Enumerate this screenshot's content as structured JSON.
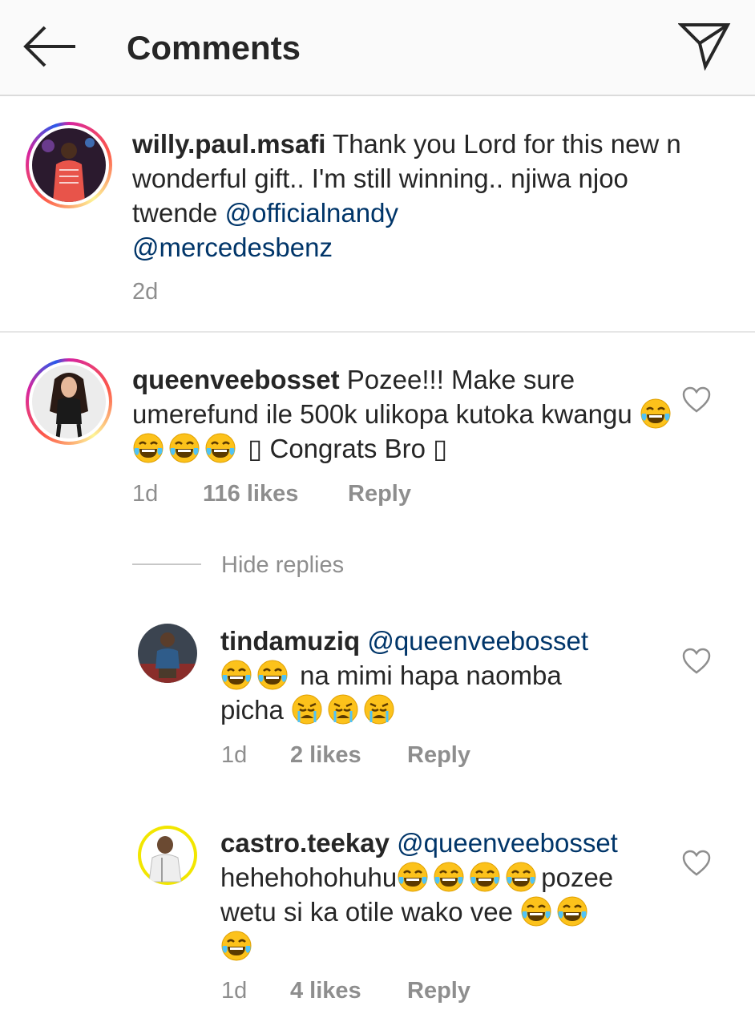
{
  "header": {
    "title": "Comments"
  },
  "caption": {
    "username": "willy.paul.msafi",
    "text": "Thank you Lord for this new n wonderful gift.. I'm still winning.. njiwa njoo twende",
    "mention1": "@officialnandy",
    "mention2": "@mercedesbenz",
    "time": "2d"
  },
  "comment1": {
    "username": "queenveebosset",
    "text_a": "Pozee!!! Make sure umerefund ile 500k ulikopa kutoka kwangu",
    "text_b": "▯ Congrats Bro ▯",
    "time": "1d",
    "likes": "116 likes",
    "reply": "Reply"
  },
  "hide_replies": "Hide replies",
  "reply1": {
    "username": "tindamuziq",
    "mention": "@queenveebosset",
    "text_a": "na mimi hapa naomba",
    "text_b": "picha",
    "time": "1d",
    "likes": "2 likes",
    "reply": "Reply"
  },
  "reply2": {
    "username": "castro.teekay",
    "mention": "@queenveebosset",
    "text_a": "hehehohohuhu",
    "text_b": "pozee",
    "text_c": "wetu si ka otile wako vee",
    "time": "1d",
    "likes": "4 likes",
    "reply": "Reply"
  },
  "colors": {
    "mention": "#003569",
    "meta": "#8e8e8e",
    "header_bg": "#fafafa"
  },
  "icons": [
    "back-arrow-icon",
    "send-icon",
    "heart-icon",
    "laughing-tears-emoji",
    "crying-emoji"
  ]
}
